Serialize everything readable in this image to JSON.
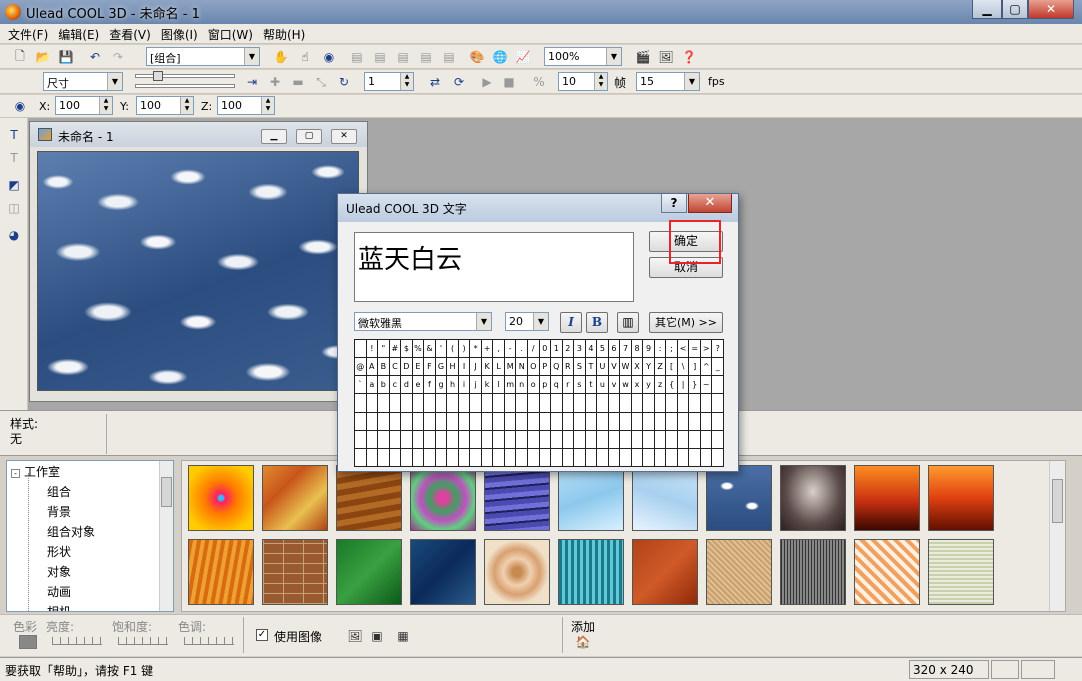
{
  "app": {
    "title": "Ulead COOL 3D - 未命名 - 1"
  },
  "menu": [
    "文件(F)",
    "编辑(E)",
    "查看(V)",
    "图像(I)",
    "窗口(W)",
    "帮助(H)"
  ],
  "toolbar1": {
    "group_combo": "[组合]",
    "zoom_combo": "100%"
  },
  "toolbar2": {
    "size_combo": "尺寸",
    "frame_value": "1",
    "fps_value": "10",
    "frame_label": "帧",
    "frame_count": "15",
    "fps_label": "fps"
  },
  "toolbar3": {
    "x_label": "X:",
    "x_value": "100",
    "y_label": "Y:",
    "y_value": "100",
    "z_label": "Z:",
    "z_value": "100"
  },
  "doc": {
    "title": "未命名 - 1"
  },
  "style_panel": {
    "label": "样式:",
    "value": "无"
  },
  "tree": {
    "root": "工作室",
    "items": [
      "组合",
      "背景",
      "组合对象",
      "形状",
      "对象",
      "动画",
      "相机"
    ]
  },
  "bottom": {
    "hue_label": "色彩",
    "brightness_label": "亮度:",
    "saturation_label": "饱和度:",
    "tone_label": "色调:",
    "use_image_label": "使用图像",
    "add_label": "添加"
  },
  "status": {
    "help_text": "要获取「帮助」，请按 F1 键",
    "size": "320 x 240"
  },
  "dialog": {
    "title": "Ulead COOL 3D 文字",
    "text": "蓝天白云",
    "ok_label": "确定",
    "cancel_label": "取消",
    "font_combo": "微软雅黑",
    "size_combo": "20",
    "italic_label": "I",
    "bold_label": "B",
    "other_label": "其它(M) >>",
    "char_rows": [
      [
        " ",
        "!",
        "\"",
        "#",
        "$",
        "%",
        "&",
        "'",
        "(",
        ")",
        "*",
        "+",
        ",",
        "-",
        ".",
        "/",
        "0",
        "1",
        "2",
        "3",
        "4",
        "5",
        "6",
        "7",
        "8",
        "9",
        ":",
        ";",
        "<",
        "=",
        ">",
        "?"
      ],
      [
        "@",
        "A",
        "B",
        "C",
        "D",
        "E",
        "F",
        "G",
        "H",
        "I",
        "J",
        "K",
        "L",
        "M",
        "N",
        "O",
        "P",
        "Q",
        "R",
        "S",
        "T",
        "U",
        "V",
        "W",
        "X",
        "Y",
        "Z",
        "[",
        "\\",
        "]",
        "^",
        "_"
      ],
      [
        "`",
        "a",
        "b",
        "c",
        "d",
        "e",
        "f",
        "g",
        "h",
        "i",
        "j",
        "k",
        "l",
        "m",
        "n",
        "o",
        "p",
        "q",
        "r",
        "s",
        "t",
        "u",
        "v",
        "w",
        "x",
        "y",
        "z",
        "{",
        "|",
        "}",
        "~",
        ""
      ]
    ]
  },
  "colors": {
    "highlight": "#e8242a",
    "titlebar": "#7a94b8"
  }
}
